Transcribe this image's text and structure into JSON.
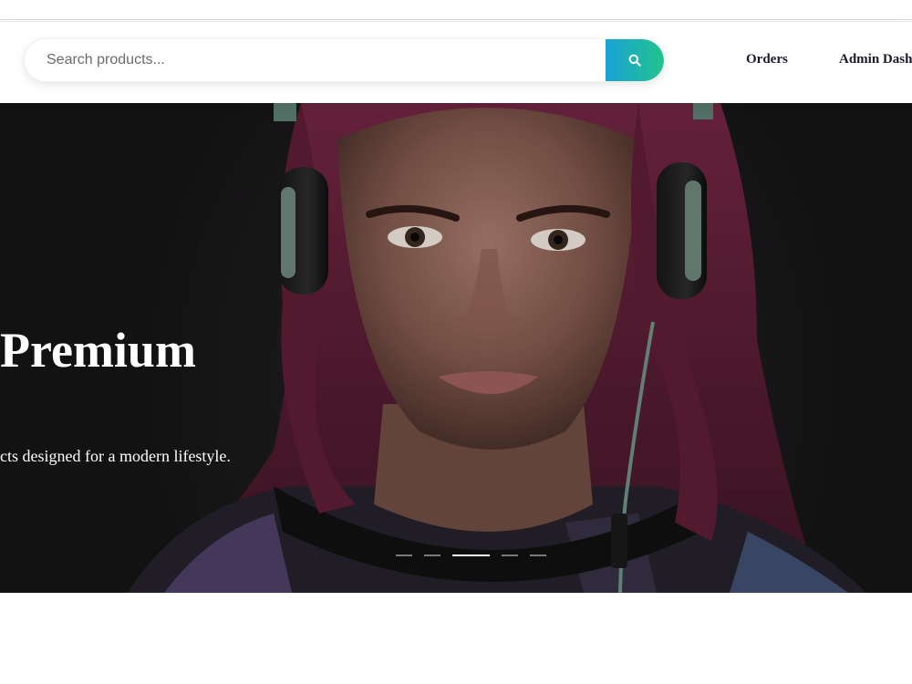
{
  "header": {
    "search": {
      "placeholder": "Search products...",
      "value": ""
    },
    "nav": {
      "orders_label": "Orders",
      "admin_label": "Admin Dashboard"
    },
    "colors": {
      "search_gradient_start": "#1aa3d6",
      "search_gradient_end": "#22c38e",
      "nav_text": "#1a1a2e"
    },
    "icons": {
      "search_button": "search-icon"
    }
  },
  "hero": {
    "title": "Premium",
    "subtitle": "cts designed for a modern lifestyle.",
    "carousel": {
      "slide_count": 5,
      "active_index": 2
    }
  }
}
